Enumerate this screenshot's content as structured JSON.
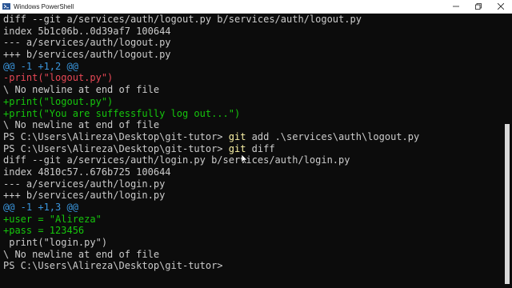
{
  "window": {
    "title": "Windows PowerShell"
  },
  "colors": {
    "background": "#0c0c0c",
    "text": "#cccccc",
    "command": "#f9f1a5",
    "hunk": "#3a96dd",
    "removed": "#e74856",
    "added": "#16c60c"
  },
  "terminal": {
    "lines": [
      {
        "segments": [
          {
            "text": "diff --git a/services/auth/logout.py b/services/auth/logout.py",
            "color": "#cccccc"
          }
        ]
      },
      {
        "segments": [
          {
            "text": "index 5b1c06b..0d39af7 100644",
            "color": "#cccccc"
          }
        ]
      },
      {
        "segments": [
          {
            "text": "--- a/services/auth/logout.py",
            "color": "#cccccc"
          }
        ]
      },
      {
        "segments": [
          {
            "text": "+++ b/services/auth/logout.py",
            "color": "#cccccc"
          }
        ]
      },
      {
        "segments": [
          {
            "text": "@@ -1 +1,2 @@",
            "color": "#3a96dd"
          }
        ]
      },
      {
        "segments": [
          {
            "text": "-print(\"logout.py\")",
            "color": "#e74856"
          }
        ]
      },
      {
        "segments": [
          {
            "text": "\\ No newline at end of file",
            "color": "#cccccc"
          }
        ]
      },
      {
        "segments": [
          {
            "text": "+print(\"logout.py\")",
            "color": "#16c60c"
          }
        ]
      },
      {
        "segments": [
          {
            "text": "+print(\"You are suffessfully log out...\")",
            "color": "#16c60c"
          }
        ]
      },
      {
        "segments": [
          {
            "text": "\\ No newline at end of file",
            "color": "#cccccc"
          }
        ]
      },
      {
        "segments": [
          {
            "text": "PS C:\\Users\\Alireza\\Desktop\\git-tutor> ",
            "color": "#cccccc"
          },
          {
            "text": "git",
            "color": "#f9f1a5"
          },
          {
            "text": " add .\\services\\auth\\logout.py",
            "color": "#cccccc"
          }
        ]
      },
      {
        "segments": [
          {
            "text": "PS C:\\Users\\Alireza\\Desktop\\git-tutor> ",
            "color": "#cccccc"
          },
          {
            "text": "git",
            "color": "#f9f1a5"
          },
          {
            "text": " diff",
            "color": "#cccccc"
          }
        ]
      },
      {
        "segments": [
          {
            "text": "diff --git a/services/auth/login.py b/services/auth/login.py",
            "color": "#cccccc"
          }
        ]
      },
      {
        "segments": [
          {
            "text": "index 4810c57..676b725 100644",
            "color": "#cccccc"
          }
        ]
      },
      {
        "segments": [
          {
            "text": "--- a/services/auth/login.py",
            "color": "#cccccc"
          }
        ]
      },
      {
        "segments": [
          {
            "text": "+++ b/services/auth/login.py",
            "color": "#cccccc"
          }
        ]
      },
      {
        "segments": [
          {
            "text": "@@ -1 +1,3 @@",
            "color": "#3a96dd"
          }
        ]
      },
      {
        "segments": [
          {
            "text": "+user = \"Alireza\"",
            "color": "#16c60c"
          }
        ]
      },
      {
        "segments": [
          {
            "text": "+pass = 123456",
            "color": "#16c60c"
          }
        ]
      },
      {
        "segments": [
          {
            "text": " print(\"login.py\")",
            "color": "#cccccc"
          }
        ]
      },
      {
        "segments": [
          {
            "text": "\\ No newline at end of file",
            "color": "#cccccc"
          }
        ]
      },
      {
        "segments": [
          {
            "text": "PS C:\\Users\\Alireza\\Desktop\\git-tutor>",
            "color": "#cccccc"
          }
        ]
      }
    ]
  }
}
